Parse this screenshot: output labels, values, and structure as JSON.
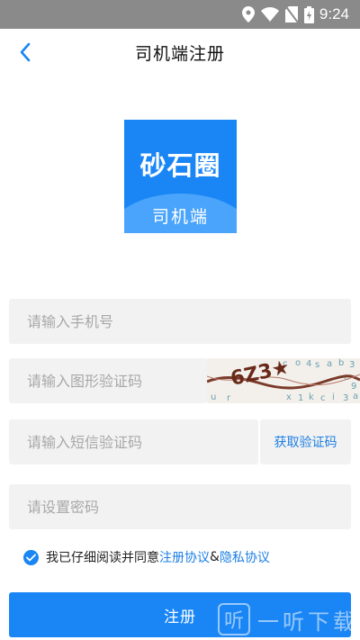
{
  "status_bar": {
    "time": "9:24",
    "icons": [
      "location-icon",
      "wifi-icon",
      "no-sim-icon",
      "battery-charging-icon"
    ]
  },
  "nav": {
    "title": "司机端注册",
    "back_icon": "chevron-left-icon"
  },
  "logo": {
    "main_text": "砂石圈",
    "sub_text": "司机端"
  },
  "form": {
    "phone_placeholder": "请输入手机号",
    "captcha_placeholder": "请输入图形验证码",
    "captcha_image_text": "6Z3★",
    "sms_placeholder": "请输入短信验证码",
    "sms_button": "获取验证码",
    "password_placeholder": "请设置密码"
  },
  "agreement": {
    "checked": true,
    "prefix": "我已仔细阅读并同意",
    "link1": "注册协议",
    "separator": "&",
    "link2": "隐私协议"
  },
  "register_button": "注册",
  "watermark": {
    "icon_text": "听",
    "text": "一听下载"
  },
  "colors": {
    "accent": "#1a86f5",
    "link": "#1c7fe3",
    "field_bg": "#f2f2f2",
    "status_bar": "#8a8a8a"
  }
}
